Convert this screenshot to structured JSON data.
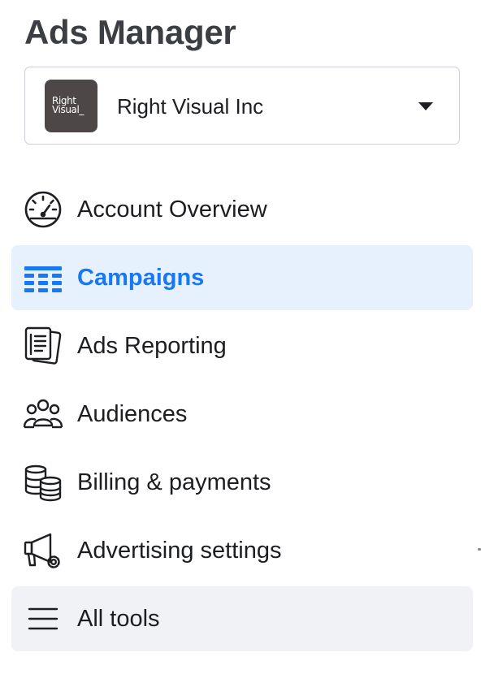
{
  "app": {
    "title": "Ads Manager"
  },
  "account": {
    "name": "Right Visual Inc",
    "logo_lines": [
      "Right",
      "Visual_"
    ]
  },
  "nav": {
    "items": [
      {
        "label": "Account Overview",
        "icon": "gauge-icon",
        "state": "default"
      },
      {
        "label": "Campaigns",
        "icon": "campaigns-grid-icon",
        "state": "selected"
      },
      {
        "label": "Ads Reporting",
        "icon": "report-pages-icon",
        "state": "default"
      },
      {
        "label": "Audiences",
        "icon": "people-group-icon",
        "state": "default"
      },
      {
        "label": "Billing & payments",
        "icon": "coin-stack-icon",
        "state": "default"
      },
      {
        "label": "Advertising settings",
        "icon": "megaphone-gear-icon",
        "state": "default"
      },
      {
        "label": "All tools",
        "icon": "hamburger-menu-icon",
        "state": "default"
      }
    ]
  },
  "colors": {
    "accent": "#1877f2",
    "selected_bg": "#e7f0fd",
    "muted_bg": "#f0f2f5",
    "text": "#1c1e21",
    "avatar_bg": "#4d4847"
  }
}
